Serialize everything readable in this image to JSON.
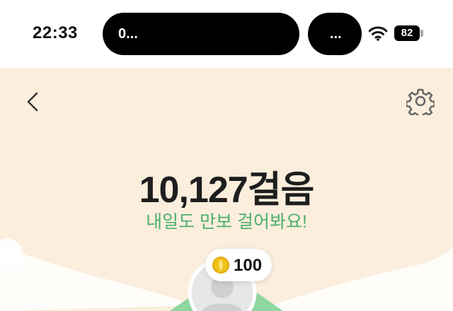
{
  "status_bar": {
    "time": "22:33",
    "pill_left_text": "0...",
    "pill_right_text": "...",
    "battery": "82"
  },
  "header": {
    "back_icon": "chevron-left-icon",
    "settings_icon": "gear-icon"
  },
  "main": {
    "step_count": "10,127걸음",
    "message": "내일도 만보 걸어봐요!"
  },
  "reward": {
    "icon": "coin-icon",
    "amount": "100"
  },
  "colors": {
    "background": "#fbeedd",
    "accent_green": "#4caf6a",
    "coin": "#f2c21b"
  }
}
